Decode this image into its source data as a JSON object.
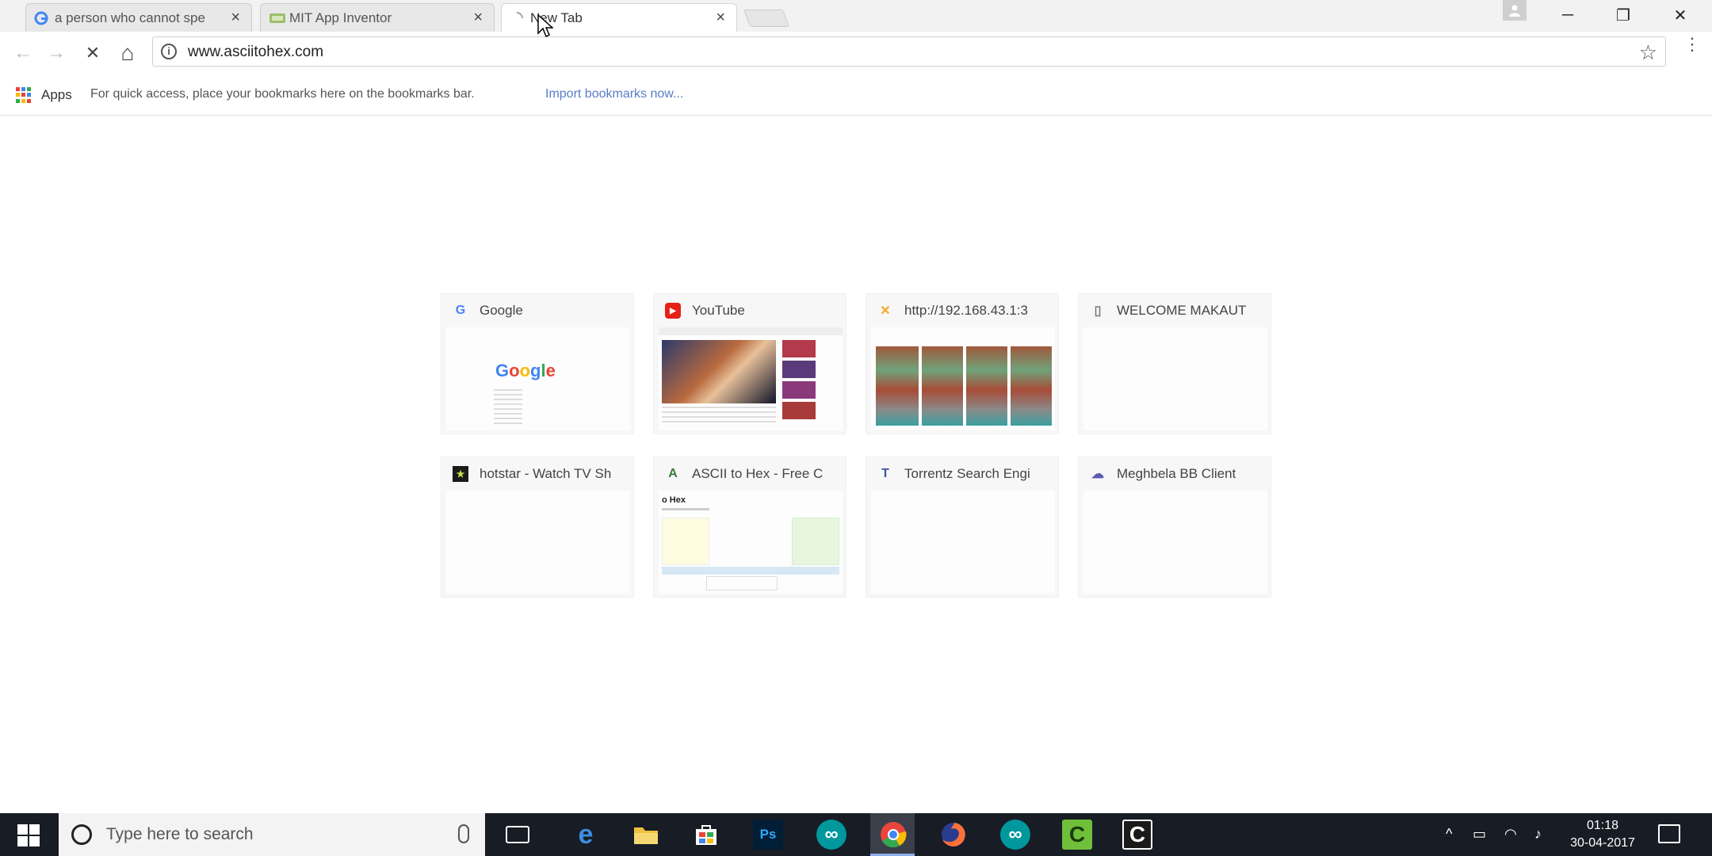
{
  "tabs": [
    {
      "label": "a person who cannot spe",
      "favicon": "google-icon",
      "state": "inactive"
    },
    {
      "label": "MIT App Inventor",
      "favicon": "mit-app-inventor-icon",
      "state": "inactive"
    },
    {
      "label": "New Tab",
      "favicon": "loading-icon",
      "state": "active"
    }
  ],
  "window_controls": {
    "minimize": "─",
    "restore": "❐",
    "close": "✕"
  },
  "toolbar": {
    "back": "←",
    "forward": "→",
    "reload": "✕",
    "home": "⌂",
    "url": "www.asciitohex.com",
    "info_glyph": "i",
    "star": "☆",
    "menu": "⋮"
  },
  "bookmarks_bar": {
    "apps_label": "Apps",
    "hint": "For quick access, place your bookmarks here on the bookmarks bar.",
    "import_link": "Import bookmarks now..."
  },
  "most_visited": [
    {
      "title": "Google",
      "favicon": "google-icon",
      "fav_glyph": "G",
      "fav_color": "#4285f4",
      "thumb_logo": "Google"
    },
    {
      "title": "YouTube",
      "favicon": "youtube-icon",
      "fav_glyph": "▶",
      "fav_color": "#e62117"
    },
    {
      "title": "http://192.168.43.1:3",
      "favicon": "xender-icon",
      "fav_glyph": "✕",
      "fav_color": "#f5a623"
    },
    {
      "title": "WELCOME MAKAUT",
      "favicon": "page-icon",
      "fav_glyph": "▯",
      "fav_color": "#777777"
    },
    {
      "title": "hotstar - Watch TV Sh",
      "favicon": "hotstar-icon",
      "fav_glyph": "★",
      "fav_color": "#1a1a1a"
    },
    {
      "title": "ASCII to Hex - Free C",
      "favicon": "asciitohex-icon",
      "fav_glyph": "A",
      "fav_color": "#3b7a3b",
      "thumb_heading": "o Hex"
    },
    {
      "title": "Torrentz Search Engi",
      "favicon": "torrentz-icon",
      "fav_glyph": "T",
      "fav_color": "#3b5998"
    },
    {
      "title": "Meghbela BB Client",
      "favicon": "meghbela-icon",
      "fav_glyph": "☁",
      "fav_color": "#5a5ab0"
    }
  ],
  "taskbar": {
    "search_placeholder": "Type here to search",
    "pinned": [
      {
        "name": "task-view-icon",
        "glyph": "⧉",
        "color": "#ffffff"
      },
      {
        "name": "edge-icon",
        "glyph": "e",
        "color": "#3b8ee0"
      },
      {
        "name": "file-explorer-icon",
        "glyph": "▬",
        "color": "#f0c040"
      },
      {
        "name": "store-icon",
        "glyph": "⊞",
        "color": "#ffffff"
      },
      {
        "name": "photoshop-icon",
        "glyph": "Ps",
        "color": "#31a8ff"
      },
      {
        "name": "arduino-icon",
        "glyph": "∞",
        "color": "#00979d"
      },
      {
        "name": "chrome-icon",
        "glyph": "◉",
        "color": "#e8453c"
      },
      {
        "name": "firefox-icon",
        "glyph": "◐",
        "color": "#ff7139"
      },
      {
        "name": "arduino-icon-2",
        "glyph": "∞",
        "color": "#00979d"
      },
      {
        "name": "camtasia-icon",
        "glyph": "C",
        "color": "#6fbf3a"
      },
      {
        "name": "camtasia-recorder-icon",
        "glyph": "C",
        "color": "#ffffff"
      }
    ],
    "tray": {
      "chevron": "^",
      "battery": "▭",
      "wifi": "◠",
      "volume": "♪"
    },
    "time": "01:18",
    "date": "30-04-2017"
  }
}
